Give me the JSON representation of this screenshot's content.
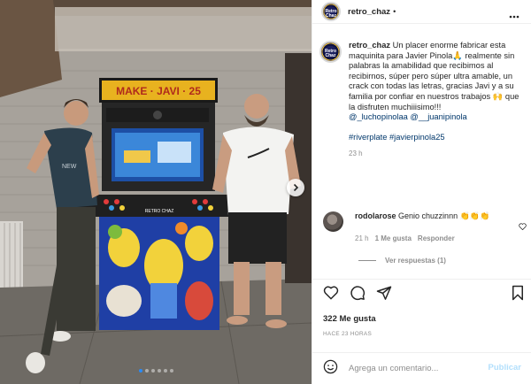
{
  "post": {
    "username": "retro_chaz",
    "separator": "•",
    "avatar_text": "Retro Chaz",
    "machine_marquee": "RETRO CHAZ",
    "caption": {
      "text": "Un placer enorme fabricar esta maquinita para Javier Pinola🙏 realmente sin palabras la amabilidad que recibimos al recibirnos, súper pero súper ultra amable, un crack con todas las letras, gracias Javi y a su familia por confiar en nuestros trabajos 🙌 que la disfruten muchiiisimo!!!",
      "mentions": [
        "@_luchopinolaa",
        "@__juanipinola"
      ],
      "hashtags": [
        "#riverplate",
        "#javierpinola25"
      ],
      "time": "23 h"
    },
    "comment": {
      "username": "rodolarose",
      "text": "Genio chuzzinnn 👏👏👏",
      "time": "21 h",
      "likes": "1 Me gusta",
      "reply_label": "Responder"
    },
    "view_replies": "Ver respuestas (1)",
    "likes": "322 Me gusta",
    "posted_ago": "HACE 23 HORAS",
    "add_comment_placeholder": "Agrega un comentario...",
    "publish_label": "Publicar",
    "carousel": {
      "count": 6,
      "active": 0
    }
  },
  "colors": {
    "link": "#00376b",
    "muted": "#8e8e8e",
    "publish_disabled": "#b2dffc",
    "carousel_active": "#2b8bf5"
  },
  "icons": [
    "more-icon",
    "heart-icon",
    "comment-icon",
    "share-icon",
    "save-icon",
    "emoji-icon",
    "chevron-right-icon"
  ]
}
